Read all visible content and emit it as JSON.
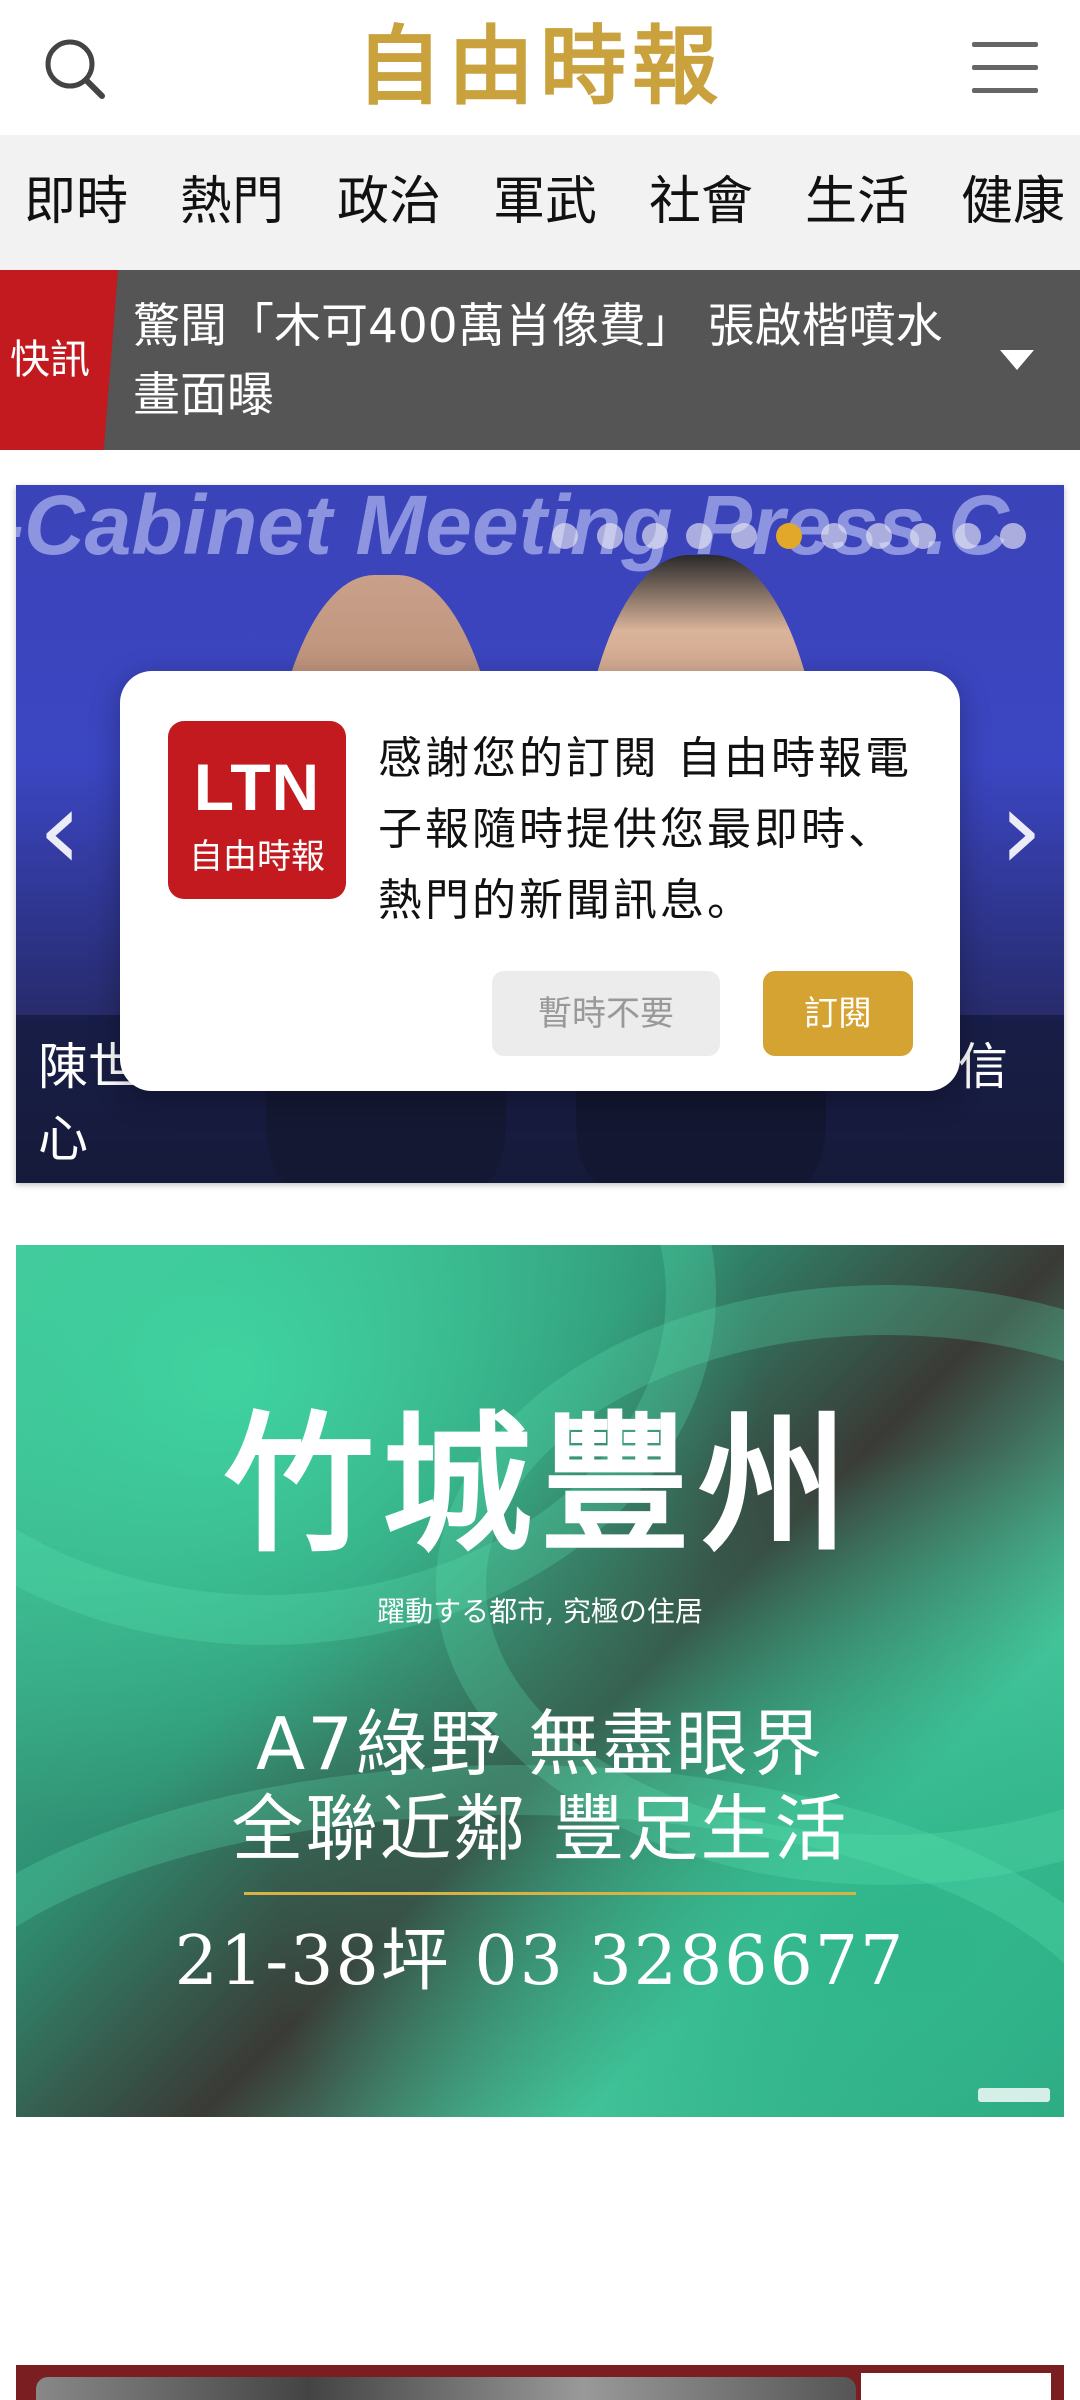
{
  "header": {
    "logo_text": "自由時報",
    "search_icon": "search-icon",
    "menu_icon": "menu-icon",
    "logo_color": "#c9a23e"
  },
  "categories": [
    "即時",
    "熱門",
    "政治",
    "軍武",
    "社會",
    "生活",
    "健康"
  ],
  "breaking": {
    "badge": "快訊",
    "text": "驚聞「木可400萬肖像費」 張啟楷噴水畫面曝",
    "dropdown_icon": "caret-down-icon",
    "badge_color": "#c21a1f"
  },
  "carousel": {
    "background_text": "-Cabinet Meeting Press.C",
    "caption_left": "陳世",
    "caption_right": "信",
    "caption_line2": "心",
    "total_slides": 11,
    "active_slide": 6,
    "prev_icon": "chevron-left-icon",
    "next_icon": "chevron-right-icon",
    "active_dot_color": "#e2a82a"
  },
  "dialog": {
    "logo_top": "LTN",
    "logo_bottom": "自由時報",
    "message": "感謝您的訂閱 自由時報電子報隨時提供您最即時、熱門的新聞訊息。",
    "later_label": "暫時不要",
    "subscribe_label": "訂閱",
    "subscribe_color": "#d4a332"
  },
  "ad": {
    "title": "竹城豐州",
    "subtitle": "躍動する都市, 究極の住居",
    "line1": "A7綠野 無盡眼界",
    "line2": "全聯近鄰 豐足生活",
    "line3": "21-38坪 03 3286677"
  }
}
